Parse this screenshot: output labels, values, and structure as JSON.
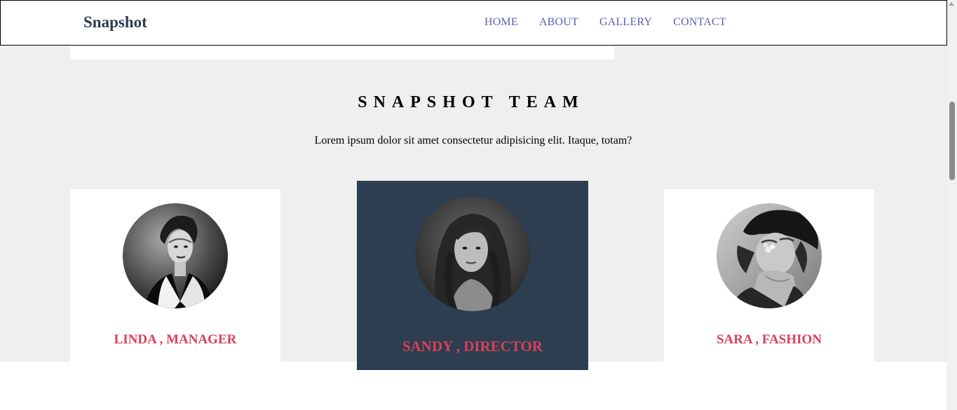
{
  "header": {
    "brand": "Snapshot",
    "nav": [
      "HOME",
      "ABOUT",
      "GALLERY",
      "CONTACT"
    ]
  },
  "team": {
    "title": "SNAPSHOT TEAM",
    "subtitle": "Lorem ipsum dolor sit amet consectetur adipisicing elit. Itaque, totam?",
    "members": [
      {
        "label": "LINDA , MANAGER"
      },
      {
        "label": "SANDY , DIRECTOR"
      },
      {
        "label": "SARA , FASHION"
      }
    ]
  },
  "colors": {
    "featured_card": "#2c3e50",
    "name_accent": "#d9405a",
    "nav_link": "#5a5fb0",
    "section_bg": "#efefef"
  }
}
